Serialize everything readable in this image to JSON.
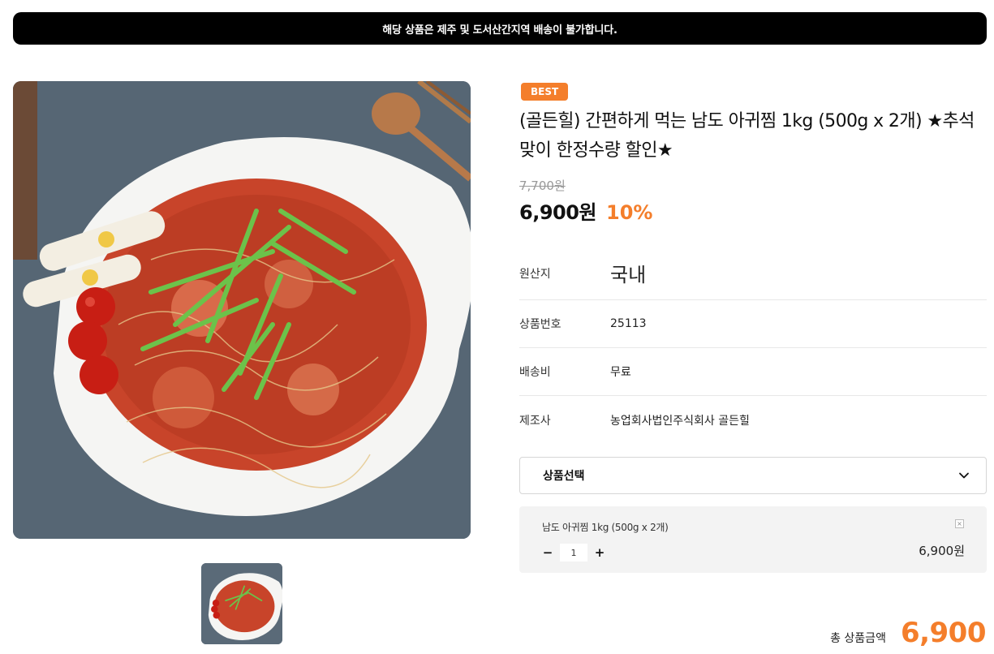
{
  "notice": "해당 상품은 제주 및 도서산간지역 배송이 불가합니다.",
  "product": {
    "badge": "BEST",
    "title": "(골든힐) 간편하게 먹는 남도 아귀찜 1kg (500g x 2개) ★추석맞이 한정수량 할인★",
    "original_price": "7,700원",
    "sale_price": "6,900원",
    "discount": "10%"
  },
  "info": [
    {
      "label": "원산지",
      "value": "국내"
    },
    {
      "label": "상품번호",
      "value": "25113"
    },
    {
      "label": "배송비",
      "value": "무료"
    },
    {
      "label": "제조사",
      "value": "농업회사법인주식회사 골든힐"
    }
  ],
  "option": {
    "label": "상품선택"
  },
  "selected": {
    "name": "남도 아귀찜 1kg (500g x 2개)",
    "quantity": "1",
    "price": "6,900원",
    "minus": "−",
    "plus": "+",
    "remove": "×"
  },
  "total": {
    "label": "총 상품금액",
    "amount": "6,900"
  },
  "colors": {
    "accent": "#f47e2b",
    "notice_bg": "#000000"
  }
}
